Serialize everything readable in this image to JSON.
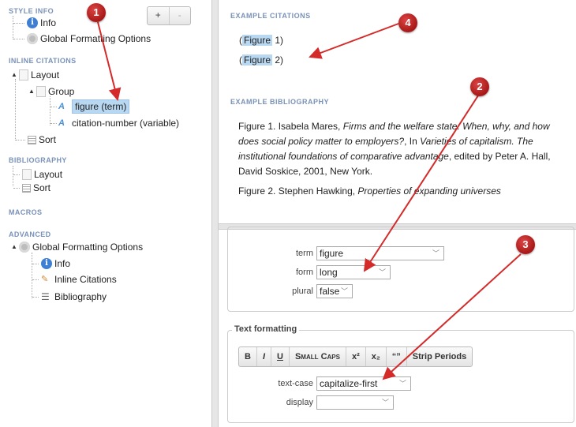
{
  "tree": {
    "style_info": "STYLE INFO",
    "info": "Info",
    "global_formatting": "Global Formatting Options",
    "inline_citations": "INLINE CITATIONS",
    "layout": "Layout",
    "group": "Group",
    "figure_term": "figure (term)",
    "citation_number": "citation-number (variable)",
    "sort": "Sort",
    "bibliography": "BIBLIOGRAPHY",
    "bib_layout": "Layout",
    "bib_sort": "Sort",
    "macros": "MACROS",
    "advanced": "ADVANCED",
    "adv_global": "Global Formatting Options",
    "adv_info": "Info",
    "adv_inline": "Inline Citations",
    "adv_bibliography": "Bibliography",
    "add_label": "+",
    "remove_label": "-"
  },
  "preview": {
    "example_citations_title": "EXAMPLE CITATIONS",
    "citations": [
      {
        "word": "Figure",
        "num": " 1)"
      },
      {
        "word": "Figure",
        "num": " 2)"
      }
    ],
    "example_bibliography_title": "EXAMPLE BIBLIOGRAPHY",
    "bib1_a": "Figure 1. Isabela Mares, ",
    "bib1_i1": "Firms and the welfare state: When, why, and how does social policy matter to employers?",
    "bib1_b": ", In ",
    "bib1_i2": "Varieties of capitalism. The institutional foundations of comparative advantage",
    "bib1_c": ", edited by Peter A. Hall, David Soskice, 2001, New York.",
    "bib2_a": "Figure 2. Stephen Hawking, ",
    "bib2_i": "Properties of expanding universes"
  },
  "editor": {
    "term_label": "term",
    "term_value": "figure",
    "form_label": "form",
    "form_value": "long",
    "plural_label": "plural",
    "plural_value": "false",
    "text_formatting": "Text formatting",
    "bold": "B",
    "italic": "I",
    "underline": "U",
    "small_caps": "Small Caps",
    "superscript": "x²",
    "subscript": "x₂",
    "quotes": "“”",
    "strip_periods": "Strip Periods",
    "text_case_label": "text-case",
    "text_case_value": "capitalize-first",
    "display_label": "display",
    "display_value": ""
  },
  "callouts": [
    "1",
    "2",
    "3",
    "4"
  ],
  "colors": {
    "accent_blue": "#3e7fd4",
    "selection": "#b8d8f2",
    "callout_red": "#c0201f",
    "section_heading": "#7a92b8"
  }
}
